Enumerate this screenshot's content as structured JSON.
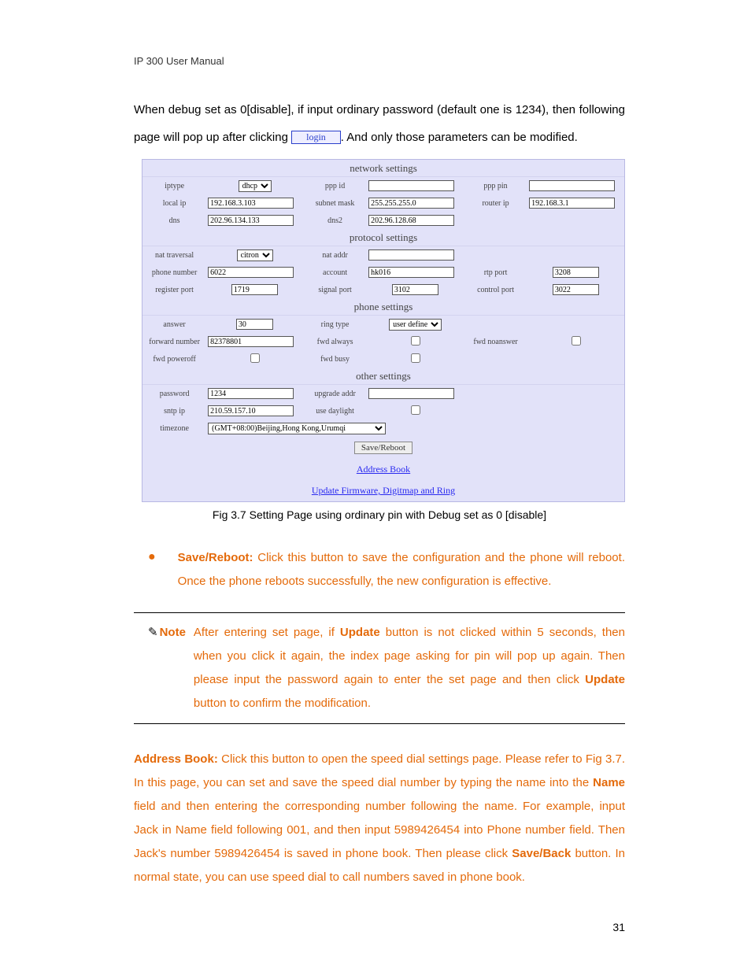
{
  "header": "IP 300 User Manual",
  "intro": {
    "part1": "When debug set as 0[disable], if input ordinary password (default one is 1234), then following page will pop up after clicking ",
    "login": "login",
    "part2": ". And only those parameters can be modified."
  },
  "panel": {
    "sections": {
      "network": "network settings",
      "protocol": "protocol settings",
      "phone": "phone settings",
      "other": "other settings"
    },
    "labels": {
      "iptype": "iptype",
      "ppp_id": "ppp id",
      "ppp_pin": "ppp pin",
      "local_ip": "local ip",
      "subnet_mask": "subnet mask",
      "router_ip": "router ip",
      "dns": "dns",
      "dns2": "dns2",
      "nat_traversal": "nat traversal",
      "nat_addr": "nat addr",
      "phone_number": "phone number",
      "account": "account",
      "rtp_port": "rtp port",
      "register_port": "register port",
      "signal_port": "signal port",
      "control_port": "control port",
      "answer": "answer",
      "ring_type": "ring type",
      "forward_number": "forward number",
      "fwd_always": "fwd always",
      "fwd_noanswer": "fwd noanswer",
      "fwd_poweroff": "fwd poweroff",
      "fwd_busy": "fwd busy",
      "password": "password",
      "upgrade_addr": "upgrade addr",
      "sntp_ip": "sntp ip",
      "use_daylight": "use daylight",
      "timezone": "timezone"
    },
    "values": {
      "iptype": "dhcp",
      "local_ip": "192.168.3.103",
      "subnet_mask": "255.255.255.0",
      "router_ip": "192.168.3.1",
      "dns": "202.96.134.133",
      "dns2": "202.96.128.68",
      "nat_traversal": "citron",
      "phone_number": "6022",
      "account": "hk016",
      "rtp_port": "3208",
      "register_port": "1719",
      "signal_port": "3102",
      "control_port": "3022",
      "answer": "30",
      "ring_type": "user define",
      "forward_number": "82378801",
      "password": "1234",
      "sntp_ip": "210.59.157.10",
      "timezone": "(GMT+08:00)Beijing,Hong Kong,Urumqi"
    },
    "save_button": "Save/Reboot",
    "addr_link": "Address Book",
    "update_link": "Update Firmware, Digitmap and Ring"
  },
  "figcaption": "Fig 3.7 Setting Page using ordinary pin with Debug set as 0 [disable]",
  "bullet": {
    "label": "Save/Reboot:",
    "text": " Click this button to save the configuration and the phone will reboot. Once the phone reboots successfully, the new configuration is effective."
  },
  "note": {
    "label": "Note",
    "line1_a": " After entering set page, if ",
    "update1": "Update",
    "line1_b": " button is not clicked within 5 seconds, then when you click it again, the index page asking for pin will pop up again. Then please input the password again to enter the set page and then click ",
    "update2": "Update",
    "line1_c": " button to confirm the modification."
  },
  "address": {
    "label": "Address Book:",
    "t1": " Click this button to open the speed dial settings page. Please refer to Fig 3.7. In this page, you can set and save the speed dial number by typing the name into the ",
    "name": "Name",
    "t2": " field and then entering the corresponding number following the name. For example, input Jack in Name field following 001, and then input 5989426454 into Phone number field. Then Jack's number 5989426454 is saved in phone book. Then please click ",
    "saveback": "Save/Back",
    "t3": " button. In normal state, you can use speed dial to call numbers saved in phone book."
  },
  "page_number": "31"
}
